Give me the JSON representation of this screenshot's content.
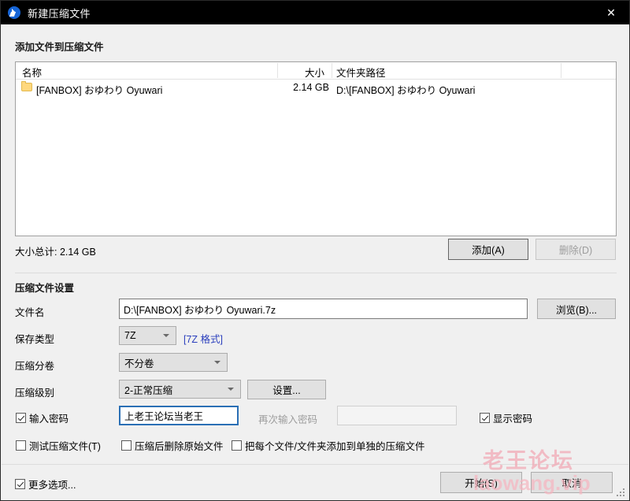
{
  "window": {
    "title": "新建压缩文件",
    "app_icon": "bandizip-icon",
    "close_label": "✕",
    "accent_color": "#1565d8"
  },
  "add_section": {
    "heading": "添加文件到压缩文件",
    "columns": [
      {
        "key": "name",
        "label": "名称"
      },
      {
        "key": "size",
        "label": "大小"
      },
      {
        "key": "path",
        "label": "文件夹路径"
      }
    ],
    "rows": [
      {
        "icon": "folder-icon",
        "name": "[FANBOX] おゆわり Oyuwari",
        "size": "2.14 GB",
        "path": "D:\\[FANBOX] おゆわり Oyuwari"
      }
    ],
    "total_size": "大小总计: 2.14 GB",
    "add_button": "添加(A)",
    "delete_button": "删除(D)",
    "delete_disabled": true
  },
  "settings_section": {
    "heading": "压缩文件设置",
    "filename_label": "文件名",
    "filename_value": "D:\\[FANBOX] おゆわり Oyuwari.7z",
    "browse_button": "浏览(B)...",
    "savetype_label": "保存类型",
    "savetype_value": "7Z",
    "format_link": "[7Z 格式]",
    "volume_label": "压缩分卷",
    "volume_value": "不分卷",
    "level_label": "压缩级别",
    "level_value": "2-正常压缩",
    "settings_button": "设置...",
    "password_checkbox": "输入密码",
    "password_checked": true,
    "password_value": "上老王论坛当老王",
    "password_confirm_label": "再次输入密码",
    "password_confirm_value": "",
    "password_confirm_disabled": true,
    "show_password_checkbox": "显示密码",
    "show_password_checked": true,
    "option_test": "测试压缩文件(T)",
    "option_test_checked": false,
    "option_delete_after": "压缩后删除原始文件",
    "option_delete_after_checked": false,
    "option_separate": "把每个文件/文件夹添加到单独的压缩文件",
    "option_separate_checked": false
  },
  "footer": {
    "more_options": "更多选项...",
    "more_options_checked": true,
    "start_button": "开始(S)",
    "cancel_button": "取消"
  },
  "watermark": {
    "cn": "老王论坛",
    "en": "laowang.vip",
    "color": "#f2a8b4"
  }
}
